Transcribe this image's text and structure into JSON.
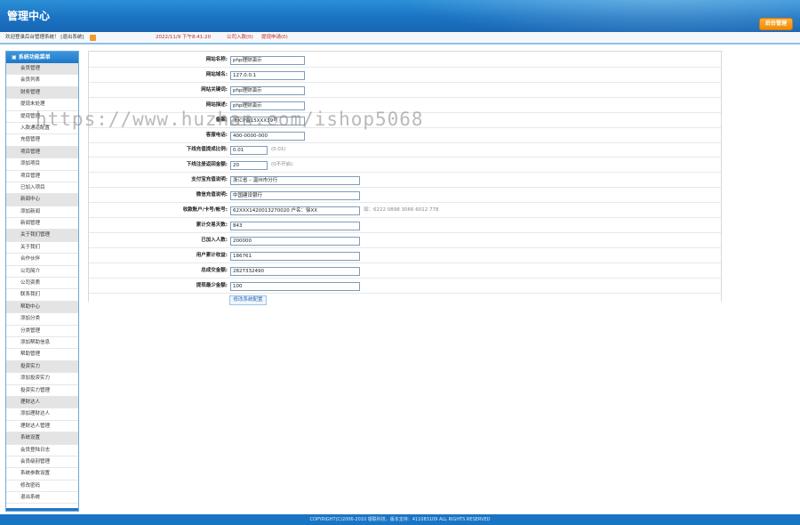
{
  "header": {
    "title": "管理中心",
    "back_button": "后台管理"
  },
  "infobar": {
    "welcome": "欢迎登录后台管理系统！ [退出系统]",
    "datetime": "2022/11/9 下午8:41:20",
    "company_count": "公司入款(0)",
    "withdraw_count": "提现申请(0)"
  },
  "sidebar": {
    "title": "系统功能菜单",
    "items": [
      {
        "label": "会员管理",
        "cat": true
      },
      {
        "label": "会员列表",
        "cat": false
      },
      {
        "label": "财务管理",
        "cat": true
      },
      {
        "label": "提现未处理",
        "cat": false
      },
      {
        "label": "提现管理",
        "cat": false
      },
      {
        "label": "入款通道配置",
        "cat": false
      },
      {
        "label": "充值管理",
        "cat": false
      },
      {
        "label": "项目管理",
        "cat": true
      },
      {
        "label": "添加项目",
        "cat": false
      },
      {
        "label": "项目管理",
        "cat": false
      },
      {
        "label": "已加入项目",
        "cat": false
      },
      {
        "label": "新闻中心",
        "cat": true
      },
      {
        "label": "添加新闻",
        "cat": false
      },
      {
        "label": "新闻管理",
        "cat": false
      },
      {
        "label": "关于我们管理",
        "cat": true
      },
      {
        "label": "关于我们",
        "cat": false
      },
      {
        "label": "合作伙伴",
        "cat": false
      },
      {
        "label": "公司简介",
        "cat": false
      },
      {
        "label": "公司资质",
        "cat": false
      },
      {
        "label": "联系我们",
        "cat": false
      },
      {
        "label": "帮助中心",
        "cat": true
      },
      {
        "label": "添加分类",
        "cat": false
      },
      {
        "label": "分类管理",
        "cat": false
      },
      {
        "label": "添加帮助信息",
        "cat": false
      },
      {
        "label": "帮助管理",
        "cat": false
      },
      {
        "label": "投资实力",
        "cat": true
      },
      {
        "label": "添加投资实力",
        "cat": false
      },
      {
        "label": "投资实力管理",
        "cat": false
      },
      {
        "label": "理财达人",
        "cat": true
      },
      {
        "label": "添加理财达人",
        "cat": false
      },
      {
        "label": "理财达人管理",
        "cat": false
      },
      {
        "label": "系统设置",
        "cat": true
      },
      {
        "label": "会员登陆日志",
        "cat": false
      },
      {
        "label": "会员级别管理",
        "cat": false
      },
      {
        "label": "系统参数设置",
        "cat": false
      },
      {
        "label": "修改密码",
        "cat": false
      },
      {
        "label": "退出系统",
        "cat": false
      }
    ]
  },
  "form": {
    "fields": [
      {
        "label": "网站名称:",
        "value": "php理财演示",
        "hint": ""
      },
      {
        "label": "网站域名:",
        "value": "127.0.0.1",
        "hint": ""
      },
      {
        "label": "网站关键词:",
        "value": "php理财演示",
        "hint": ""
      },
      {
        "label": "网站描述:",
        "value": "php理财演示",
        "hint": ""
      },
      {
        "label": "备案:",
        "value": "浙ICP备15XXX39号",
        "hint": ""
      },
      {
        "label": "客服电话:",
        "value": "400-0000-000",
        "hint": ""
      },
      {
        "label": "下线充值提成比例:",
        "value": "0.01",
        "hint": "(0.01)"
      },
      {
        "label": "下线注册返回金额:",
        "value": "20",
        "hint": "(0不开启)"
      },
      {
        "label": "支付宝充值说明:",
        "value": "浙江省 – 温州市分行",
        "hint": ""
      },
      {
        "label": "微信充值说明:",
        "value": "中国建设银行",
        "hint": ""
      },
      {
        "label": "收款账户/卡号/帐号:",
        "value": "62XXX1420013270020 户名：徐XX",
        "hint": "如：6222 0898 3066 6012 778"
      },
      {
        "label": "累计交易天数:",
        "value": "843",
        "hint": ""
      },
      {
        "label": "已加入人数:",
        "value": "200000",
        "hint": ""
      },
      {
        "label": "用户累计收益:",
        "value": "186761",
        "hint": ""
      },
      {
        "label": "总成交金额:",
        "value": "2827332490",
        "hint": ""
      },
      {
        "label": "提现最少金额:",
        "value": "100",
        "hint": ""
      }
    ],
    "submit_label": "修改系统配置"
  },
  "watermark": "https://www.huzhan.com/ishop5068",
  "footer": {
    "copyright": "COPYRIGHT(C)2006-2010 银联科技，版本支持：411083109 ALL RIGHTS RESERVED"
  }
}
